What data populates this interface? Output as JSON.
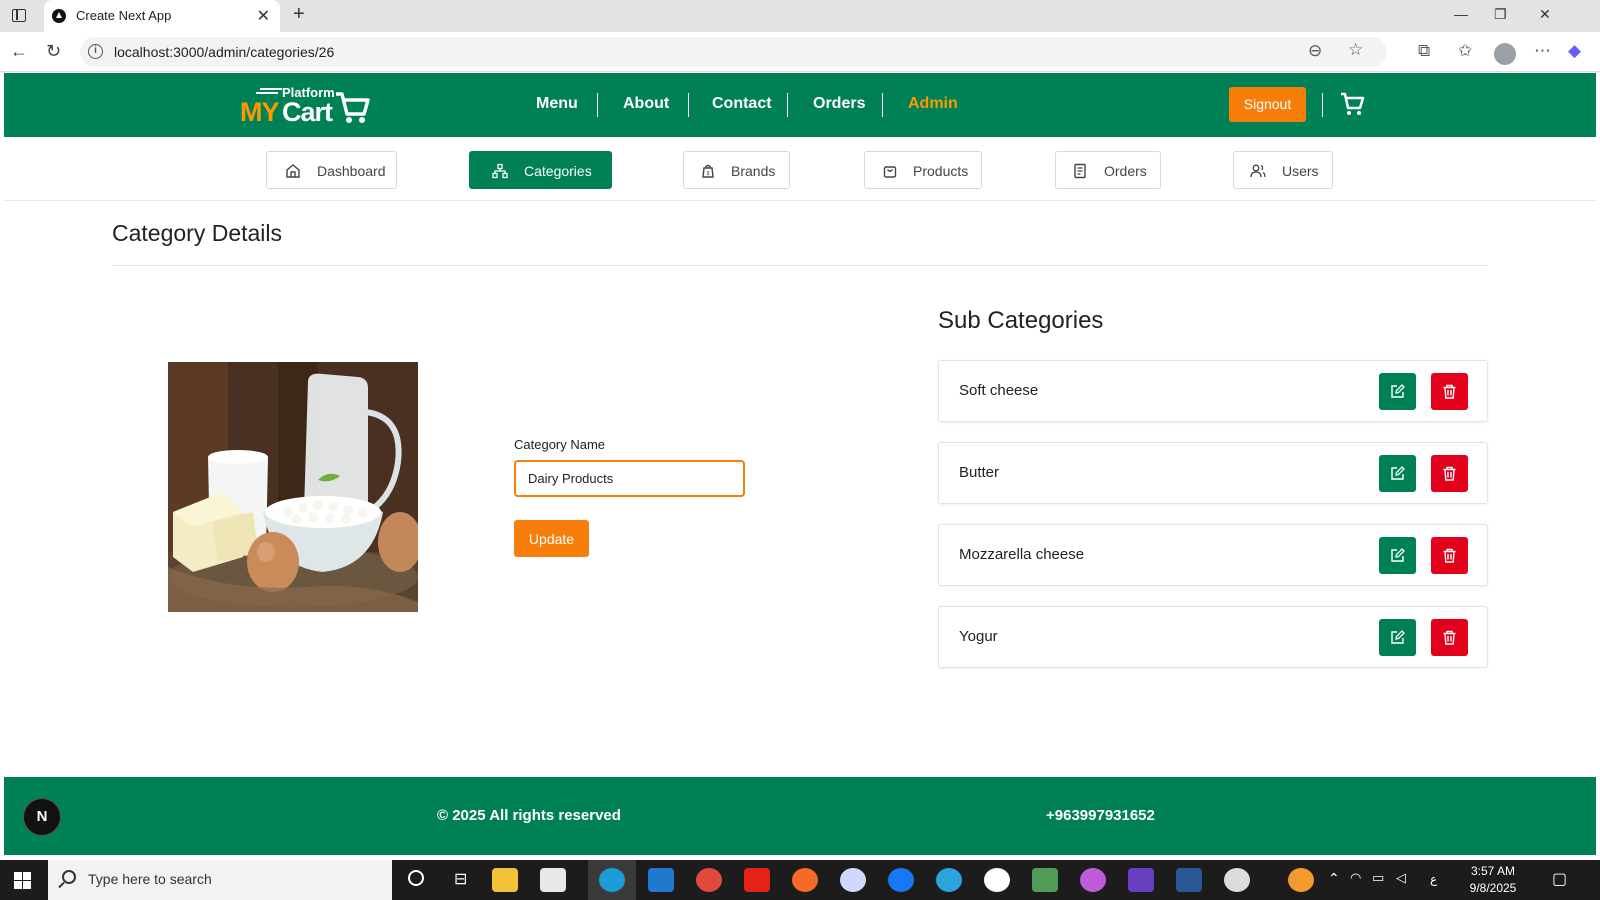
{
  "browser": {
    "tab_title": "Create Next App",
    "url": "localhost:3000/admin/categories/26"
  },
  "header": {
    "logo_platform": "Platform",
    "logo_my": "MY",
    "logo_cart": "Cart",
    "nav": [
      "Menu",
      "About",
      "Contact",
      "Orders",
      "Admin"
    ],
    "signout_label": "Signout",
    "accent_color": "#f77e0b",
    "brand_color": "#008055"
  },
  "admin_nav": {
    "tabs": [
      "Dashboard",
      "Categories",
      "Brands",
      "Products",
      "Orders",
      "Users"
    ],
    "active": "Categories"
  },
  "main": {
    "page_title": "Category Details",
    "category_name_label": "Category Name",
    "category_name_value": "Dairy Products",
    "update_label": "Update",
    "sub_title": "Sub Categories",
    "sub_categories": [
      "Soft cheese",
      "Butter",
      "Mozzarella cheese",
      "Yogur"
    ]
  },
  "footer": {
    "copyright": "© 2025 All rights reserved",
    "phone": "+963997931652",
    "badge": "N"
  },
  "taskbar": {
    "search_placeholder": "Type here to search",
    "time": "3:57 AM",
    "date": "9/8/2025",
    "lang": "ع"
  }
}
